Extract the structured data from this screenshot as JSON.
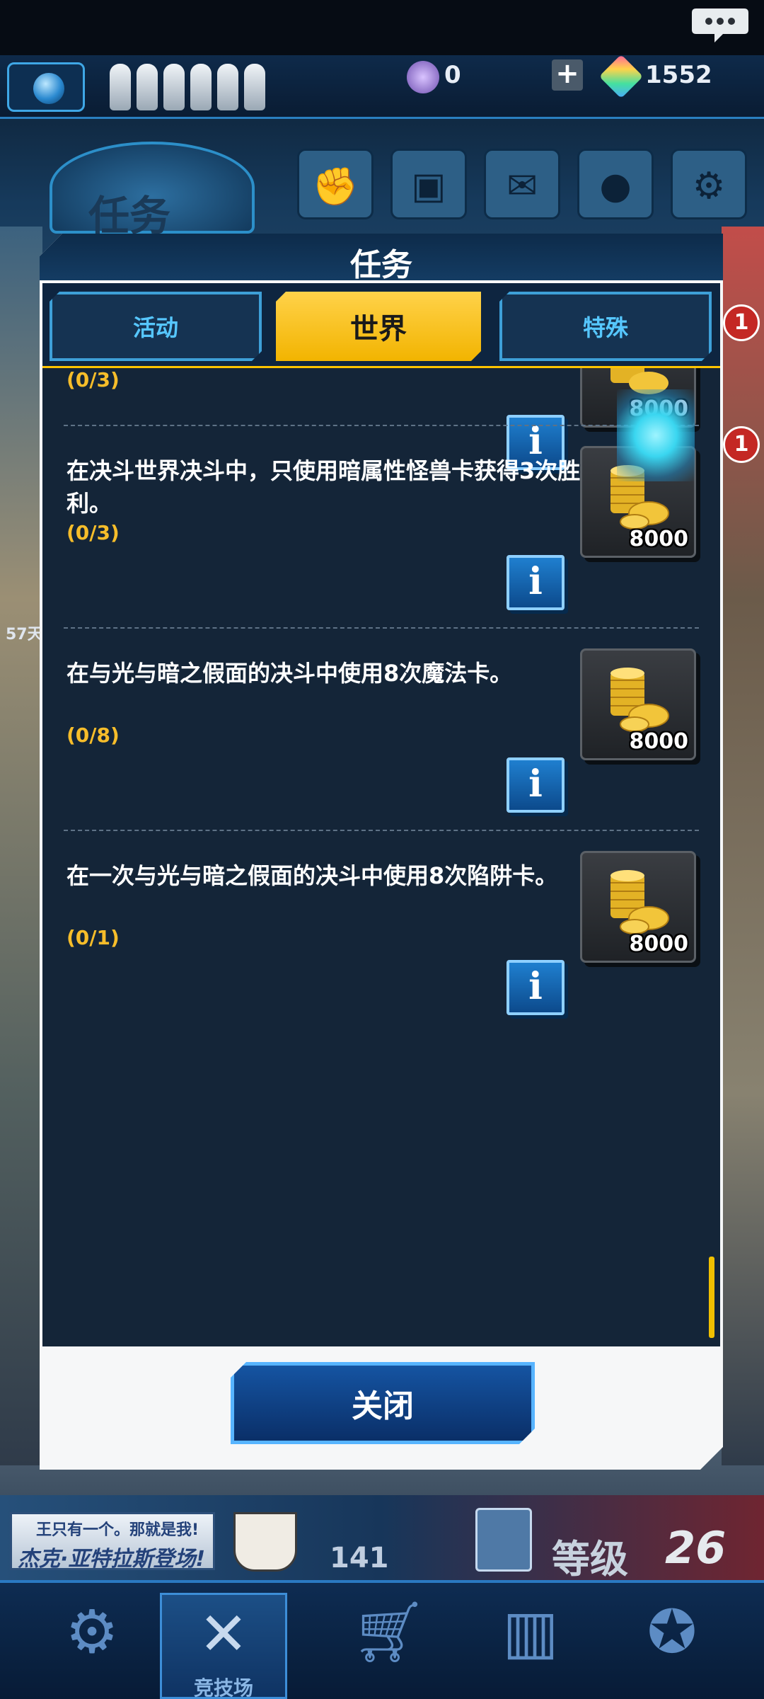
{
  "header": {
    "duelist_points": "0",
    "gems": "1552"
  },
  "background": {
    "screen_title": "任务",
    "badge_1": "1",
    "badge_2": "1",
    "side_text": "57天",
    "icons": [
      "gloves-icon",
      "duel-disk-icon",
      "mail-icon",
      "profile-icon",
      "settings-icon"
    ]
  },
  "modal": {
    "title": "任务",
    "tabs": [
      {
        "label": "活动",
        "active": false
      },
      {
        "label": "世界",
        "active": true
      },
      {
        "label": "特殊",
        "active": false
      }
    ],
    "missions": [
      {
        "desc": "",
        "progress": "(0/3)",
        "reward": "8000"
      },
      {
        "desc": "在决斗世界决斗中，只使用暗属性怪兽卡获得3次胜利。",
        "progress": "(0/3)",
        "reward": "8000"
      },
      {
        "desc": "在与光与暗之假面的决斗中使用8次魔法卡。",
        "progress": "(0/8)",
        "reward": "8000"
      },
      {
        "desc": "在一次与光与暗之假面的决斗中使用8次陷阱卡。",
        "progress": "(0/1)",
        "reward": "8000"
      }
    ],
    "info_label": "i",
    "close_label": "关闭"
  },
  "bottom": {
    "banner_line1": "王只有一个。那就是我!",
    "banner_line2": "杰克·亚特拉斯登场!",
    "gate_count": "141",
    "level_label": "等级",
    "level_value": "26",
    "nav": [
      {
        "label": "",
        "icon": "card-trader-icon"
      },
      {
        "label": "竞技场",
        "icon": "crossed-swords-icon",
        "active": true
      },
      {
        "label": "",
        "icon": "shop-cart-icon"
      },
      {
        "label": "",
        "icon": "cards-icon"
      },
      {
        "label": "",
        "icon": "duelist-emblem-icon"
      }
    ]
  },
  "colors": {
    "accent_yellow": "#ffc400",
    "progress_gold": "#f6bd2a",
    "panel_dark": "#142538",
    "button_blue": "#1554a2"
  }
}
